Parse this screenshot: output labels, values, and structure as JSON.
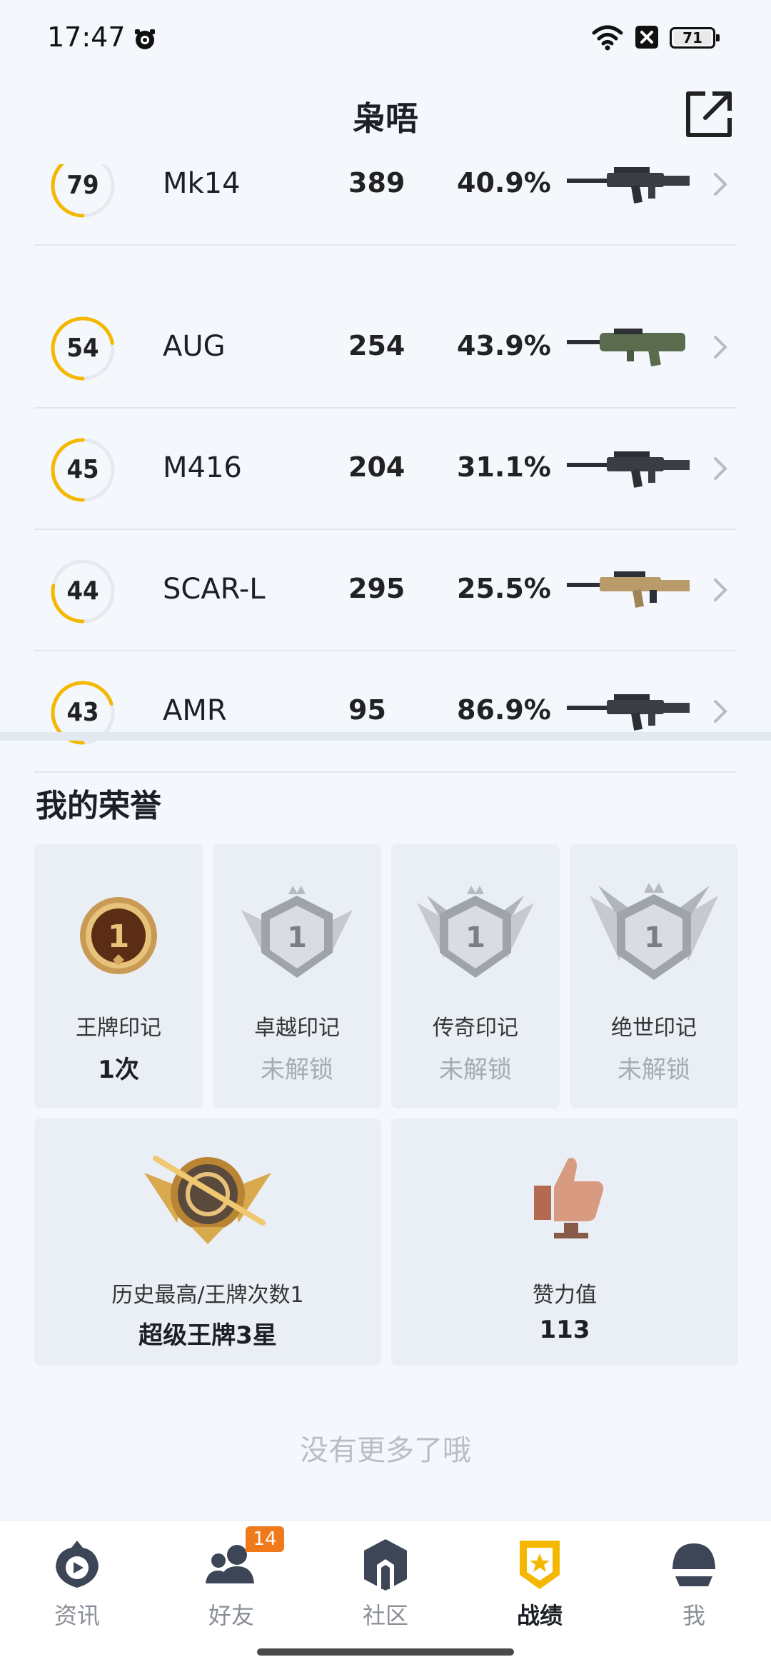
{
  "status_bar": {
    "time": "17:47",
    "battery": "71"
  },
  "header": {
    "title": "枭唔"
  },
  "weapons": [
    {
      "level": "79",
      "level_progress": 0.45,
      "name": "Mk14",
      "count": "389",
      "rate": "40.9%"
    },
    {
      "level": "54",
      "level_progress": 0.72,
      "name": "AUG",
      "count": "254",
      "rate": "43.9%"
    },
    {
      "level": "45",
      "level_progress": 0.5,
      "name": "M416",
      "count": "204",
      "rate": "31.1%"
    },
    {
      "level": "44",
      "level_progress": 0.28,
      "name": "SCAR-L",
      "count": "295",
      "rate": "25.5%"
    },
    {
      "level": "43",
      "level_progress": 0.7,
      "name": "AMR",
      "count": "95",
      "rate": "86.9%"
    }
  ],
  "honors": {
    "title": "我的荣誉",
    "marks": [
      {
        "label": "王牌印记",
        "value": "1次",
        "locked": false
      },
      {
        "label": "卓越印记",
        "value": "未解锁",
        "locked": true
      },
      {
        "label": "传奇印记",
        "value": "未解锁",
        "locked": true
      },
      {
        "label": "绝世印记",
        "value": "未解锁",
        "locked": true
      }
    ],
    "best": {
      "label": "历史最高/王牌次数1",
      "value": "超级王牌3星"
    },
    "likes": {
      "label": "赞力值",
      "value": "113"
    }
  },
  "footer_text": "没有更多了哦",
  "nav": {
    "items": [
      {
        "label": "资讯"
      },
      {
        "label": "好友",
        "badge": "14"
      },
      {
        "label": "社区"
      },
      {
        "label": "战绩"
      },
      {
        "label": "我"
      }
    ],
    "active": "战绩"
  },
  "colors": {
    "accent": "#f5b800",
    "ring_track": "#e6e9ee",
    "badge": "#f07a1a"
  }
}
